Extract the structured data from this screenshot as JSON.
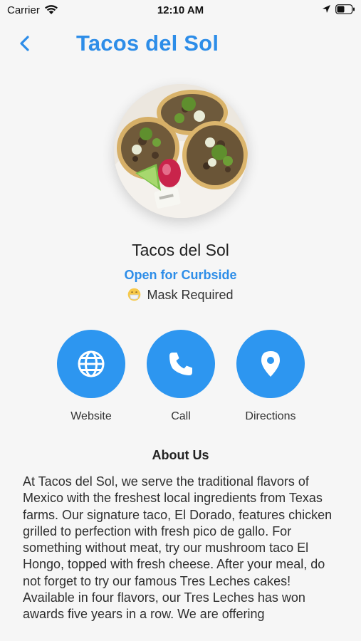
{
  "status_bar": {
    "carrier": "Carrier",
    "time": "12:10 AM"
  },
  "nav": {
    "title": "Tacos del Sol",
    "back_icon": "chevron-left-icon"
  },
  "profile": {
    "name": "Tacos del Sol",
    "status": "Open for Curbside",
    "mask_label": "Mask Required"
  },
  "actions": [
    {
      "label": "Website",
      "icon": "globe-icon"
    },
    {
      "label": "Call",
      "icon": "phone-icon"
    },
    {
      "label": "Directions",
      "icon": "location-pin-icon"
    }
  ],
  "about": {
    "title": "About Us",
    "body": "At Tacos del Sol, we serve the traditional flavors of Mexico with the freshest local ingredients from Texas farms. Our signature taco, El Dorado, features chicken grilled to perfection with fresh pico de gallo. For something without meat, try our mushroom taco El Hongo, topped with fresh cheese. After your meal, do not forget to try our famous Tres Leches cakes! Available in four flavors, our Tres Leches has won awards five years in a row. We are offering"
  },
  "colors": {
    "accent": "#2d8de8",
    "button": "#2d96f0",
    "background": "#f6f6f6"
  }
}
